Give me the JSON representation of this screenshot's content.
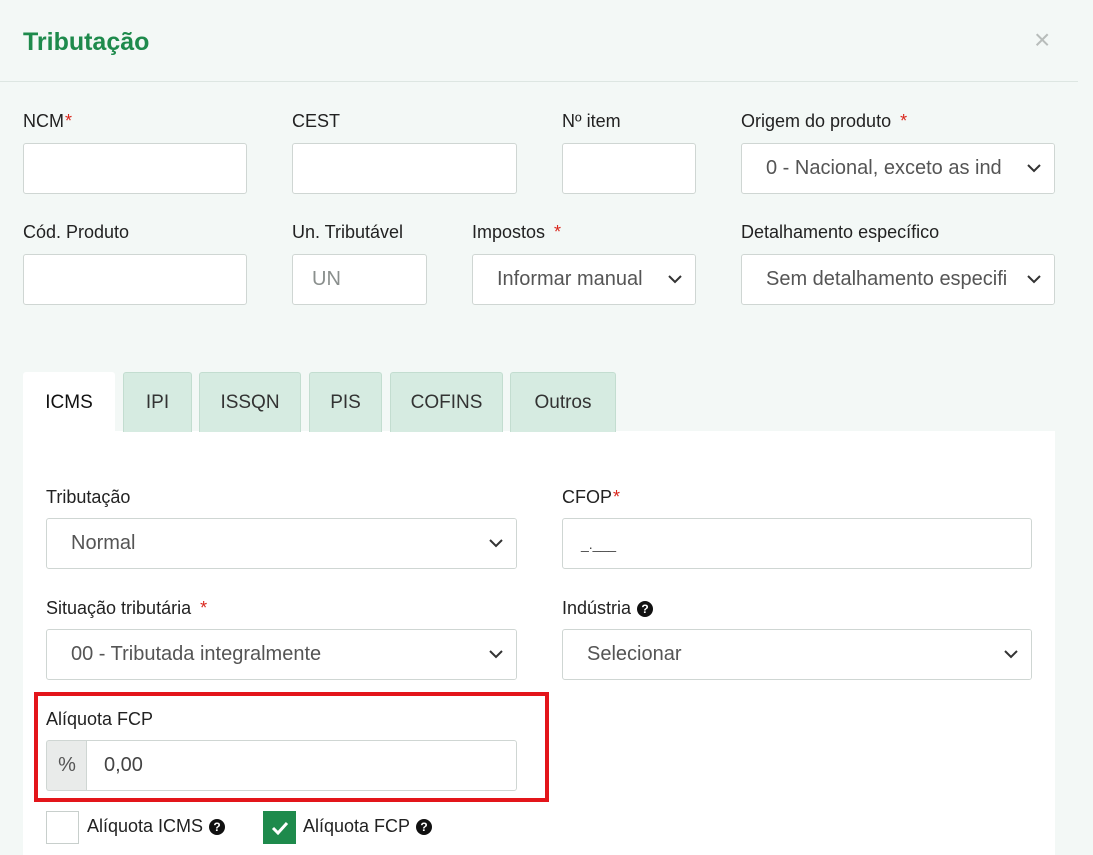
{
  "modal": {
    "title": "Tributação",
    "close_icon": "×"
  },
  "fields": {
    "ncm": {
      "label": "NCM",
      "required": "*",
      "value": ""
    },
    "cest": {
      "label": "CEST",
      "value": ""
    },
    "n_item": {
      "label": "Nº item",
      "value": ""
    },
    "origem": {
      "label": "Origem do produto",
      "required": "*",
      "value": "0 - Nacional, exceto as ind"
    },
    "cod_produto": {
      "label": "Cód. Produto",
      "value": ""
    },
    "un_tributavel": {
      "label": "Un. Tributável",
      "placeholder": "UN"
    },
    "impostos": {
      "label": "Impostos",
      "required": "*",
      "value": "Informar manual"
    },
    "detalhamento": {
      "label": "Detalhamento específico",
      "value": "Sem detalhamento especifi"
    }
  },
  "tabs": [
    {
      "label": "ICMS",
      "active": true
    },
    {
      "label": "IPI"
    },
    {
      "label": "ISSQN"
    },
    {
      "label": "PIS"
    },
    {
      "label": "COFINS"
    },
    {
      "label": "Outros"
    }
  ],
  "icms": {
    "tributacao": {
      "label": "Tributação",
      "value": "Normal"
    },
    "cfop": {
      "label": "CFOP",
      "required": "*",
      "value": "_.___"
    },
    "situacao": {
      "label": "Situação tributária",
      "required": "*",
      "value": "00 - Tributada integralmente"
    },
    "industria": {
      "label": "Indústria",
      "value": "Selecionar"
    },
    "aliquota_fcp": {
      "label": "Alíquota FCP",
      "prefix": "%",
      "value": "0,00"
    },
    "chk_icms": {
      "label": "Alíquota ICMS",
      "checked": false
    },
    "chk_fcp": {
      "label": "Alíquota FCP",
      "checked": true
    }
  },
  "colors": {
    "accent": "#1e8a4c",
    "highlight": "#e3151a",
    "tab_bg": "#d6ebe1"
  }
}
